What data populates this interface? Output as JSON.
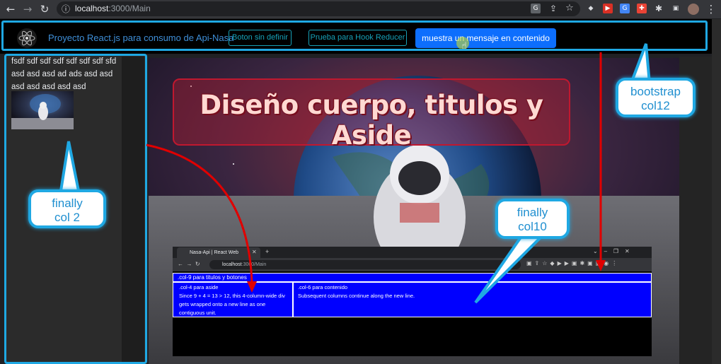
{
  "browser": {
    "url_host": "localhost",
    "url_path": ":3000/Main"
  },
  "navbar": {
    "brand": "Proyecto React.js para consumo de Api-Nasa",
    "button1": "Boton sin definir",
    "button2": "Prueba para Hook Reducer",
    "button3": "muestra un mensaje en contenido"
  },
  "aside": {
    "text": "fsdf sdf sdf sdf sdf sdf sdf sfd asd asd asd ad ads asd asd asd asd asd asd asd"
  },
  "main": {
    "title": "Diseño cuerpo, titulos y Aside"
  },
  "annotations": {
    "bootstrap": "bootstrap col12",
    "col2": "finally col 2",
    "col10": "finally col10"
  },
  "inner_screenshot": {
    "tab_title": "Nasa-Api | React Web",
    "url_host": "localhost",
    "url_path": ":3000/Main",
    "row1": ".col-9 para titulos y botones",
    "aside_title": ".col-4 para aside",
    "aside_text": "Since 9 + 4 = 13 > 12, this 4-column-wide div gets wrapped onto a new line as one contiguous unit.",
    "content_title": ".col-6 para contenido",
    "content_text": "Subsequent columns continue along the new line."
  },
  "colors": {
    "callout_border": "#1fa8e3",
    "arrow": "#e00000",
    "primary": "#0d6efd",
    "outline": "#17a2b8",
    "inner_blue": "#0000ff"
  },
  "icons": [
    "back-icon",
    "forward-icon",
    "reload-icon",
    "info-icon",
    "translate-icon",
    "share-icon",
    "star-icon",
    "puzzle-icon",
    "sidebar-icon",
    "avatar",
    "menu-icon",
    "react-logo"
  ]
}
